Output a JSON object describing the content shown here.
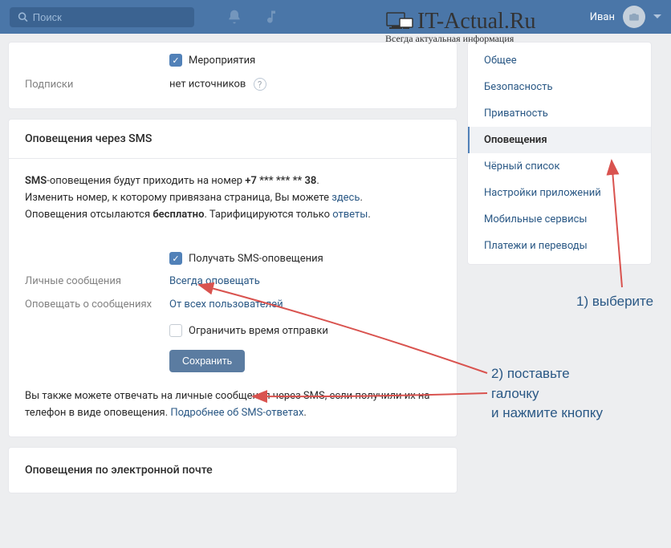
{
  "header": {
    "search_placeholder": "Поиск",
    "user_name": "Иван"
  },
  "watermark": {
    "main": "IT-Actual.Ru",
    "sub": "Всегда актуальная информация"
  },
  "sidebar": {
    "items": [
      {
        "label": "Общее"
      },
      {
        "label": "Безопасность"
      },
      {
        "label": "Приватность"
      },
      {
        "label": "Оповещения"
      },
      {
        "label": "Чёрный список"
      },
      {
        "label": "Настройки приложений"
      },
      {
        "label": "Мобильные сервисы"
      },
      {
        "label": "Платежи и переводы"
      }
    ]
  },
  "top_card": {
    "event_label": "Мероприятия",
    "subscriptions_label": "Подписки",
    "subscriptions_value": "нет источников"
  },
  "sms_card": {
    "title": "Оповещения через SMS",
    "info_prefix": "SMS",
    "info_line1_a": "-оповещения будут приходить на номер ",
    "info_phone": "+7 *** *** ** 38",
    "info_line2_a": "Изменить номер, к которому привязана страница, Вы можете ",
    "info_line2_link": "здесь",
    "info_line3_a": "Оповещения отсылаются ",
    "info_line3_bold": "бесплатно",
    "info_line3_b": ". Тарифицируются только ",
    "info_line3_link": "ответы",
    "receive_label": "Получать SMS-оповещения",
    "personal_label": "Личные сообщения",
    "personal_value": "Всегда оповещать",
    "notify_label": "Оповещать о сообщениях",
    "notify_value": "От всех пользователей",
    "limit_label": "Ограничить время отправки",
    "save_button": "Сохранить",
    "footnote_a": "Вы также можете ",
    "footnote_bold1": "отвечать",
    "footnote_b": " на личные сообщения ",
    "footnote_bold2": "через SMS",
    "footnote_c": ", если получили их на телефон в виде оповещения. ",
    "footnote_link": "Подробнее об SMS-ответах"
  },
  "email_card": {
    "title": "Оповещения по электронной почте"
  },
  "annotations": {
    "a1": "1) выберите",
    "a2_l1": "2) поставьте",
    "a2_l2": "галочку",
    "a2_l3": "и нажмите кнопку"
  }
}
